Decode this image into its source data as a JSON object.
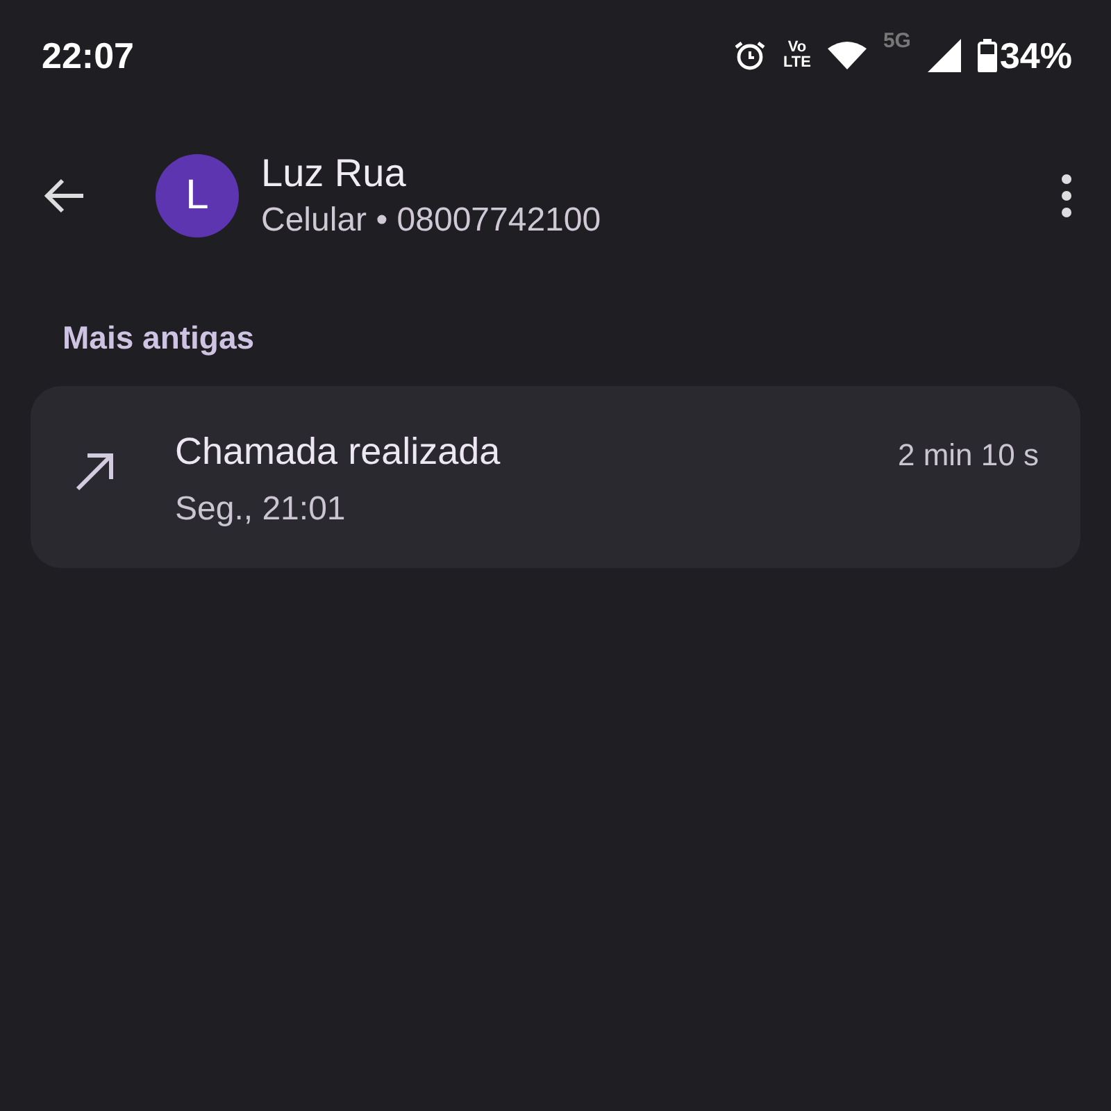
{
  "status_bar": {
    "time": "22:07",
    "volte_top": "Vo",
    "volte_bottom": "LTE",
    "network": "5G",
    "battery": "34%"
  },
  "contact": {
    "initial": "L",
    "name": "Luz Rua",
    "details": "Celular • 08007742100"
  },
  "section": "Mais antigas",
  "calls": [
    {
      "kind": "outgoing",
      "title": "Chamada realizada",
      "when": "Seg., 21:01",
      "duration": "2 min 10 s"
    }
  ]
}
